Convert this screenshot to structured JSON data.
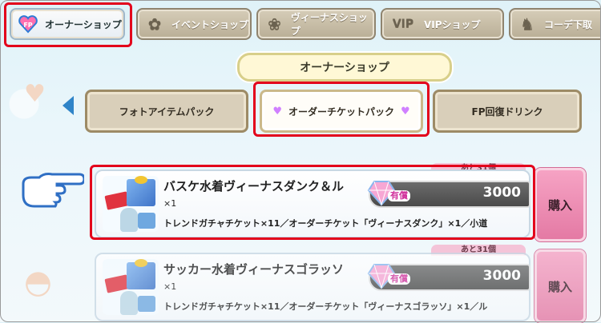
{
  "top_tabs": [
    {
      "label": "オーナーショップ",
      "icon": "fp-heart-icon",
      "active": true
    },
    {
      "label": "イベントショップ",
      "icon": "bouquet-icon",
      "active": false
    },
    {
      "label": "ヴィーナスショップ",
      "icon": "venus-emblem-icon",
      "active": false
    },
    {
      "label": "VIPショップ",
      "icon": "vip-logo-icon",
      "active": false
    },
    {
      "label": "コーデ下取",
      "icon": "outfit-icon",
      "active": false
    }
  ],
  "shop_heading": "オーナーショップ",
  "category_tabs": [
    {
      "label": "フォトアイテムパック",
      "active": false
    },
    {
      "label": "オーダーチケットパック",
      "active": true
    },
    {
      "label": "FP回復ドリンク",
      "active": false
    }
  ],
  "items": [
    {
      "remaining": "あと31個",
      "name": "バスケ水着ヴィーナスダンク＆ル",
      "qty": "×1",
      "price_tag": "有償",
      "price": "3000",
      "description": "トレンドガチャチケット×11／オーダーチケット「ヴィーナスダンク」×1／小道",
      "buy_label": "購入"
    },
    {
      "remaining": "あと31個",
      "name": "サッカー水着ヴィーナスゴラッソ",
      "qty": "×1",
      "price_tag": "有償",
      "price": "3000",
      "description": "トレンドガチャチケット×11／オーダーチケット「ヴィーナスゴラッソ」×1／ル",
      "buy_label": "購入"
    }
  ],
  "colors": {
    "highlight": "#e3001b",
    "buy": "#e47aa4",
    "heading_border": "#d8cf8a"
  }
}
